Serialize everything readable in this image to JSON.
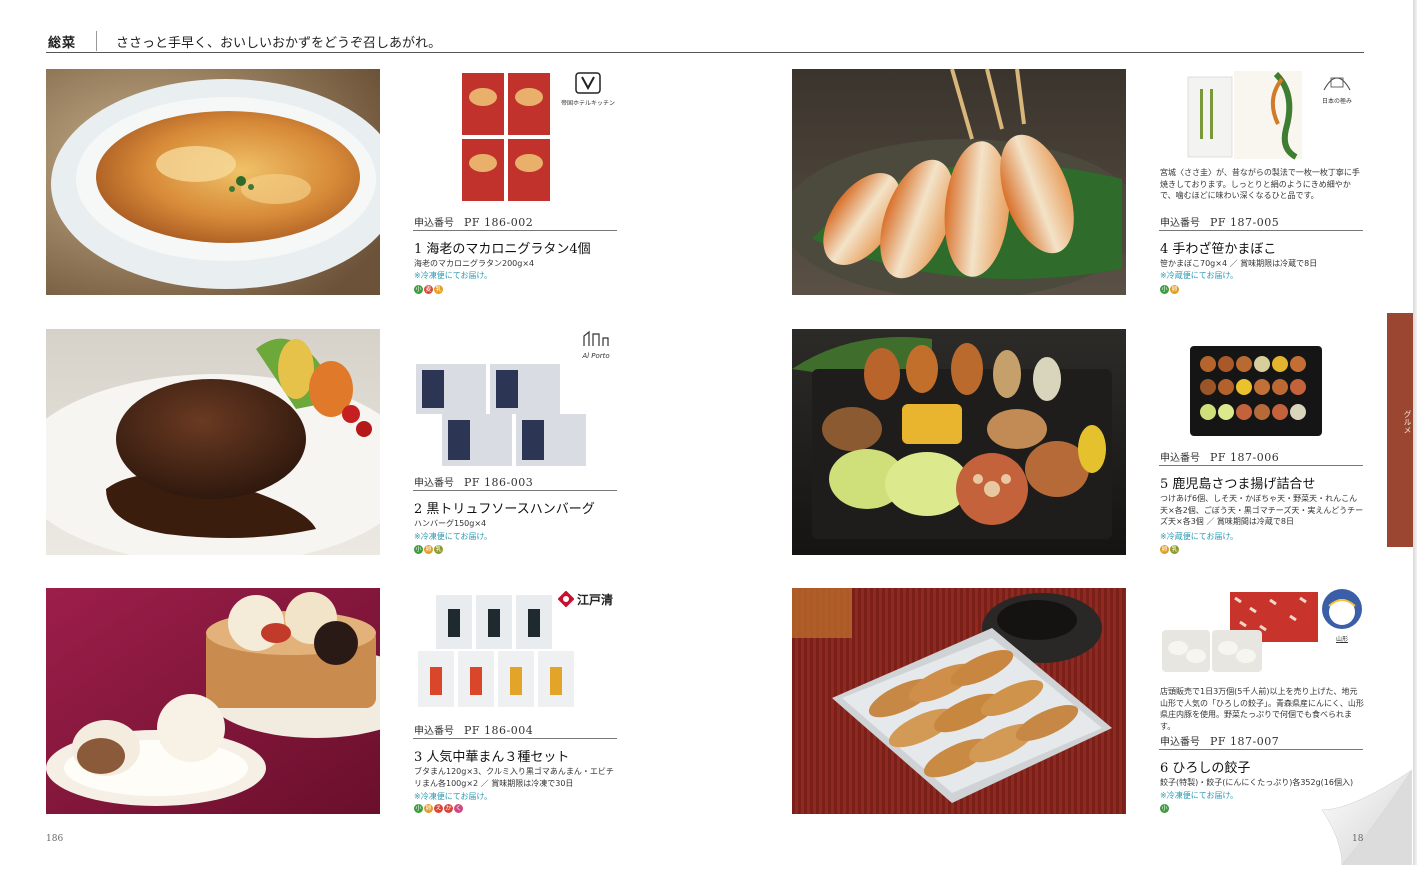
{
  "header": {
    "category": "総菜",
    "tagline": "ささっと手早く、おいしいおかずをどうぞ召しあがれ。"
  },
  "side_tab": {
    "label": "グルメ"
  },
  "footer": {
    "page_left": "186",
    "page_right": "18"
  },
  "code_label": "申込番号",
  "items": [
    {
      "code": "PF 186-002",
      "title": "1 海老のマカロニグラタン4個",
      "desc": "海老のマカロニグラタン200g×4",
      "note": "※冷凍便にてお届け。",
      "badges": [
        "小",
        "麦",
        "乳"
      ],
      "brand": "帝国ホテルキッチン"
    },
    {
      "code": "PF 186-003",
      "title": "2 黒トリュフソースハンバーグ",
      "desc": "ハンバーグ150g×4",
      "note": "※冷凍便にてお届け。",
      "badges": [
        "小",
        "卵",
        "乳"
      ],
      "brand": "Al Porto"
    },
    {
      "code": "PF 186-004",
      "title": "3 人気中華まん３種セット",
      "desc": "ブタまん120g×3、クルミ入り黒ゴマあんまん・エビチリまん各100g×2 ／ 賞味期限は冷凍で30日",
      "note": "※冷凍便にてお届け。",
      "badges": [
        "小",
        "卵",
        "え",
        "か",
        "く"
      ],
      "brand": "江戸清"
    },
    {
      "code": "PF 187-005",
      "desc_top": "宮城〈ささ圭〉が、昔ながらの製法で一枚一枚丁寧に手焼きしております。しっとりと絹のようにきめ細やかで、噛むほどに味わい深くなるひと品です。",
      "title": "4 手わざ笹かまぼこ",
      "desc": "笹かまぼこ70g×4 ／ 賞味期限は冷蔵で8日",
      "note": "※冷蔵便にてお届け。",
      "badges": [
        "小",
        "卵"
      ],
      "brand": "日本の極み"
    },
    {
      "code": "PF 187-006",
      "title": "5 鹿児島さつま揚げ詰合せ",
      "desc": "つけあげ6個、しそ天・かぼちゃ天・野菜天・れんこん天×各2個、ごぼう天・黒ゴマチーズ天・実えんどうチーズ天×各3個 ／ 賞味期間は冷蔵で8日",
      "note": "※冷蔵便にてお届け。",
      "badges": [
        "卵",
        "乳"
      ],
      "brand": ""
    },
    {
      "code": "PF 187-007",
      "desc_top": "店頭販売で1日3万個(5千人前)以上を売り上げた、地元山形で人気の「ひろしの餃子」。青森県産にんにく、山形県庄内豚を使用。野菜たっぷりで何個でも食べられます。",
      "title": "6 ひろしの餃子",
      "desc": "餃子(特製)・餃子(にんにくたっぷり)各352g(16個入)",
      "note": "※冷凍便にてお届け。",
      "badges": [
        "小"
      ],
      "brand": "山形"
    }
  ],
  "badge_colors": {
    "小": "#3b9a3c",
    "麦": "#d8473a",
    "乳": "#e29b23",
    "卵": "#e29b23",
    "え": "#d8473a",
    "か": "#d8473a",
    "く": "#cc4a80"
  }
}
